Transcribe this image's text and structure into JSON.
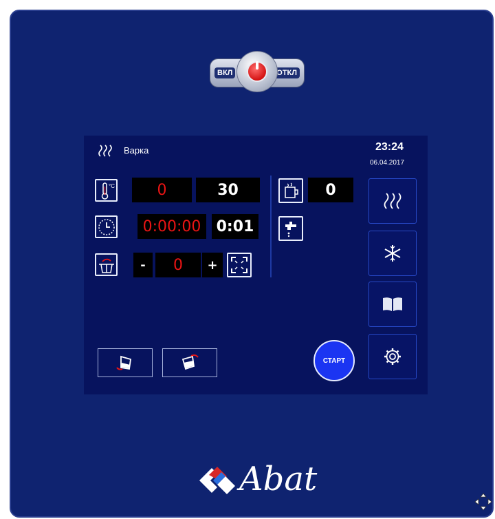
{
  "power_switch": {
    "on_label": "ВКЛ",
    "off_label": "ОТКЛ"
  },
  "header": {
    "mode_label": "Варка",
    "time": "23:24",
    "date": "06.04.2017"
  },
  "temperature": {
    "unit_label": "°C",
    "current": "0",
    "target": "30"
  },
  "timer": {
    "elapsed": "0:00:00",
    "set": "0:01"
  },
  "tilt": {
    "minus": "-",
    "value": "0",
    "plus": "+"
  },
  "water": {
    "value": "0"
  },
  "start_label": "СТАРТ",
  "brand": {
    "name": "Abat"
  },
  "colors": {
    "panel": "#0f2370",
    "screen": "#07135e",
    "active_value": "#e91414",
    "start": "#1b35f2"
  },
  "icons": [
    "thermometer-icon",
    "clock-icon",
    "tilt-icon",
    "fullscreen-icon",
    "cup-icon",
    "faucet-icon",
    "steam-icon",
    "snowflake-icon",
    "book-icon",
    "gear-icon",
    "pour-left-icon",
    "pour-right-icon",
    "move-icon"
  ]
}
